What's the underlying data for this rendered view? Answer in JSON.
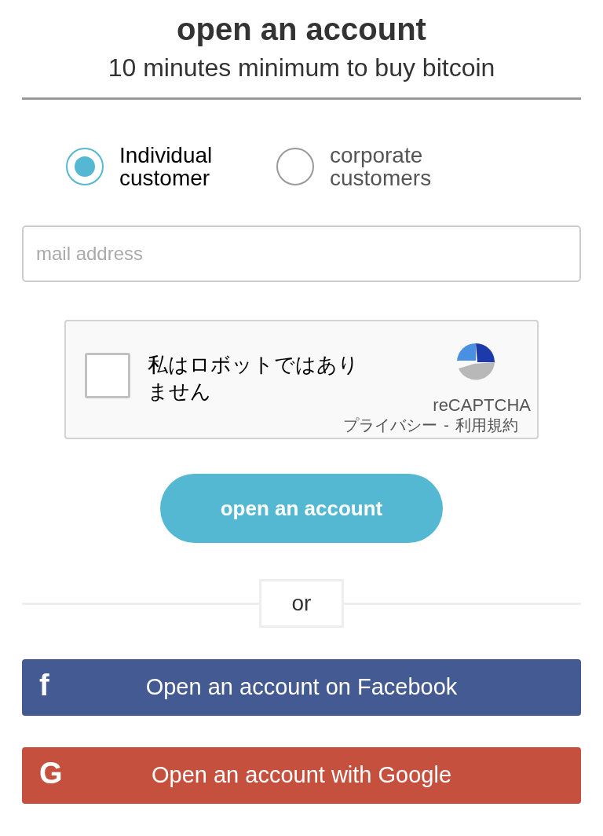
{
  "header": {
    "title": "open an account",
    "subtitle": "10 minutes minimum to buy bitcoin"
  },
  "customer_types": [
    {
      "label": "Individual customer",
      "selected": true
    },
    {
      "label": "corporate customers",
      "selected": false
    }
  ],
  "email": {
    "placeholder": "mail address"
  },
  "captcha": {
    "label": "私はロボットではありません",
    "checked": false,
    "brand": "reCAPTCHA",
    "privacy": "プライバシー",
    "separator": "-",
    "terms": "利用規約"
  },
  "submit": "open an account",
  "divider": "or",
  "social_buttons": [
    {
      "kind": "facebook",
      "icon": "f",
      "label": "Open an account on Facebook"
    },
    {
      "kind": "google",
      "icon": "G",
      "label": "Open an account with Google"
    }
  ]
}
